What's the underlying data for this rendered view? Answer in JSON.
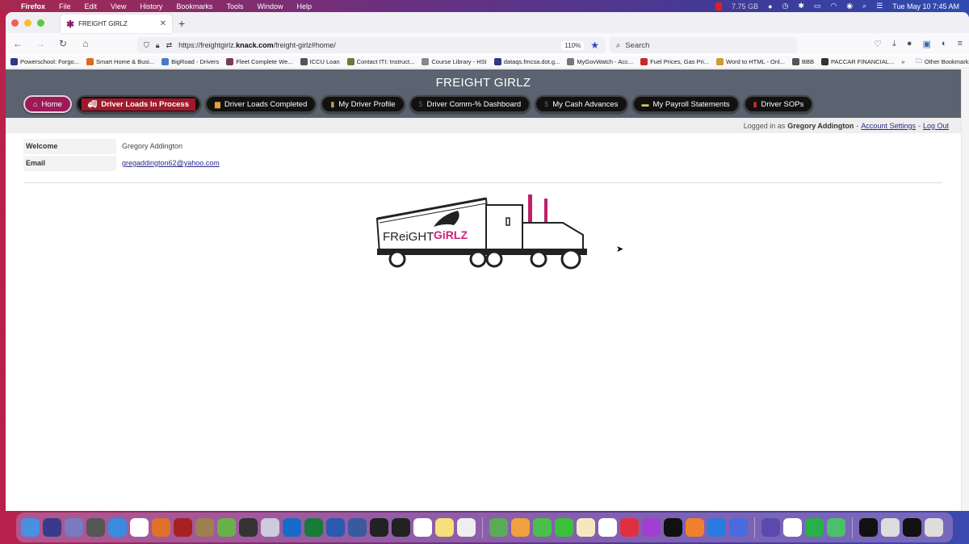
{
  "menubar": {
    "app": "Firefox",
    "items": [
      "File",
      "Edit",
      "View",
      "History",
      "Bookmarks",
      "Tools",
      "Window",
      "Help"
    ],
    "memory": "7.75 GB",
    "datetime": "Tue May 10  7:45 AM"
  },
  "browser": {
    "tab_title": "FREIGHT GIRLZ",
    "url_prefix": "https://freightgirlz.",
    "url_domain": "knack.com",
    "url_path": "/freight-girlz#home/",
    "zoom_level": "110%",
    "search_placeholder": "Search",
    "bookmarks": [
      {
        "label": "Powerschool: Forgo...",
        "color": "#2b3a8a"
      },
      {
        "label": "Smart Home & Busi...",
        "color": "#e06a1a"
      },
      {
        "label": "BigRoad - Drivers",
        "color": "#4a7ac8"
      },
      {
        "label": "Fleet Complete We...",
        "color": "#7a3a5a"
      },
      {
        "label": "ICCU Loan",
        "color": "#555"
      },
      {
        "label": "Contact ITI: Instruct...",
        "color": "#6a7a3a"
      },
      {
        "label": "Course Library - HSI",
        "color": "#888"
      },
      {
        "label": "dataqs.fmcsa.dot.g...",
        "color": "#2a3a8a"
      },
      {
        "label": "MyGovWatch - Acc...",
        "color": "#777"
      },
      {
        "label": "Fuel Prices, Gas Pri...",
        "color": "#c82a2a"
      },
      {
        "label": "Word to HTML - Onl...",
        "color": "#c8a02a"
      },
      {
        "label": "BBB",
        "color": "#555"
      },
      {
        "label": "PACCAR FINANCIAL...",
        "color": "#333"
      }
    ],
    "other_bookmarks": "Other Bookmarks"
  },
  "site": {
    "title": "FREIGHT GIRLZ",
    "nav": [
      {
        "label": "Home",
        "icon": "home-icon"
      },
      {
        "label": "Driver Loads In Process",
        "icon": "truck-icon"
      },
      {
        "label": "Driver Loads Completed",
        "icon": "truck-icon"
      },
      {
        "label": "My Driver Profile",
        "icon": "profile-icon"
      },
      {
        "label": "Driver Comm-% Dashboard",
        "icon": "dollar-icon"
      },
      {
        "label": "My Cash Advances",
        "icon": "dollar-icon"
      },
      {
        "label": "My Payroll Statements",
        "icon": "money-icon"
      },
      {
        "label": "Driver SOPs",
        "icon": "book-icon"
      }
    ],
    "login": {
      "prefix": "Logged in as",
      "user": "Gregory Addington",
      "sep": "-",
      "account_settings": "Account Settings",
      "logout": "Log Out"
    },
    "details": [
      {
        "label": "Welcome",
        "value": "Gregory Addington",
        "link": false
      },
      {
        "label": "Email",
        "value": "gregaddington62@yahoo.com",
        "link": true
      }
    ],
    "logo_text_1": "FReiGHT",
    "logo_text_2": "GiRLZ"
  },
  "colors": {
    "header_bg": "#5b6371",
    "home_btn": "#9b1a58",
    "active_btn": "#a0182a",
    "logo_pink": "#d0207a"
  }
}
